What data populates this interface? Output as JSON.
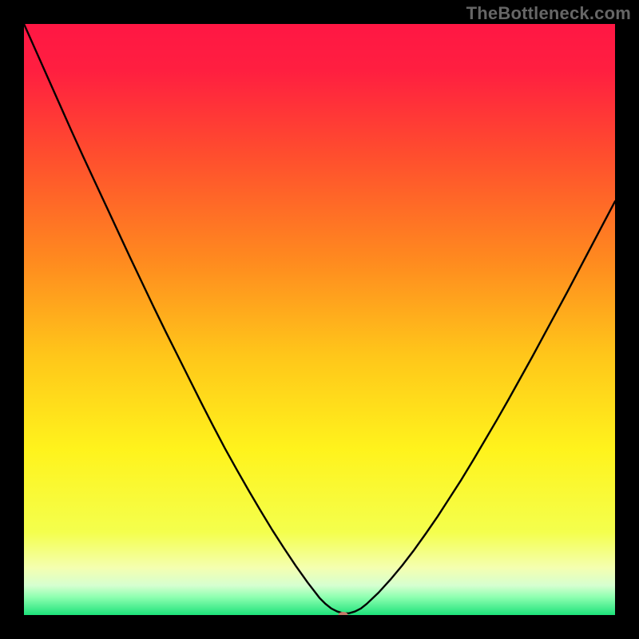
{
  "watermark": "TheBottleneck.com",
  "chart_data": {
    "type": "line",
    "title": "",
    "xlabel": "",
    "ylabel": "",
    "xlim": [
      0,
      100
    ],
    "ylim": [
      0,
      100
    ],
    "grid": false,
    "legend": false,
    "marker": {
      "x": 54,
      "y": 0,
      "color": "#c47b6a",
      "rx": 6,
      "ry": 4
    },
    "series": [
      {
        "name": "bottleneck-curve",
        "color": "#000000",
        "x": [
          0,
          2,
          4,
          6,
          8,
          10,
          12,
          14,
          16,
          18,
          20,
          22,
          24,
          26,
          28,
          30,
          32,
          34,
          36,
          38,
          40,
          42,
          44,
          46,
          48,
          50,
          51,
          52,
          53,
          54,
          55,
          56,
          57,
          58,
          60,
          62,
          64,
          66,
          68,
          70,
          72,
          74,
          76,
          78,
          80,
          82,
          84,
          86,
          88,
          90,
          92,
          94,
          96,
          98,
          100
        ],
        "y": [
          100,
          95.5,
          91,
          86.5,
          82,
          77.6,
          73.3,
          69,
          64.7,
          60.4,
          56.2,
          52,
          47.9,
          43.9,
          39.9,
          35.9,
          32,
          28.2,
          24.6,
          21.1,
          17.7,
          14.4,
          11.3,
          8.3,
          5.5,
          2.9,
          1.9,
          1.1,
          0.6,
          0.3,
          0.3,
          0.6,
          1.1,
          1.9,
          3.8,
          6.0,
          8.4,
          11.0,
          13.8,
          16.7,
          19.8,
          22.9,
          26.2,
          29.6,
          33.0,
          36.5,
          40.1,
          43.7,
          47.4,
          51.1,
          54.8,
          58.6,
          62.4,
          66.2,
          70.0
        ]
      }
    ],
    "background_gradient": {
      "stops": [
        {
          "offset": 0.0,
          "color": "#ff1744"
        },
        {
          "offset": 0.08,
          "color": "#ff1f40"
        },
        {
          "offset": 0.22,
          "color": "#ff4d2e"
        },
        {
          "offset": 0.4,
          "color": "#ff8a1f"
        },
        {
          "offset": 0.56,
          "color": "#ffc61a"
        },
        {
          "offset": 0.72,
          "color": "#fff31c"
        },
        {
          "offset": 0.86,
          "color": "#f4ff4d"
        },
        {
          "offset": 0.92,
          "color": "#f4ffb0"
        },
        {
          "offset": 0.95,
          "color": "#d6ffd0"
        },
        {
          "offset": 0.97,
          "color": "#8dffb0"
        },
        {
          "offset": 1.0,
          "color": "#1de27a"
        }
      ]
    }
  }
}
